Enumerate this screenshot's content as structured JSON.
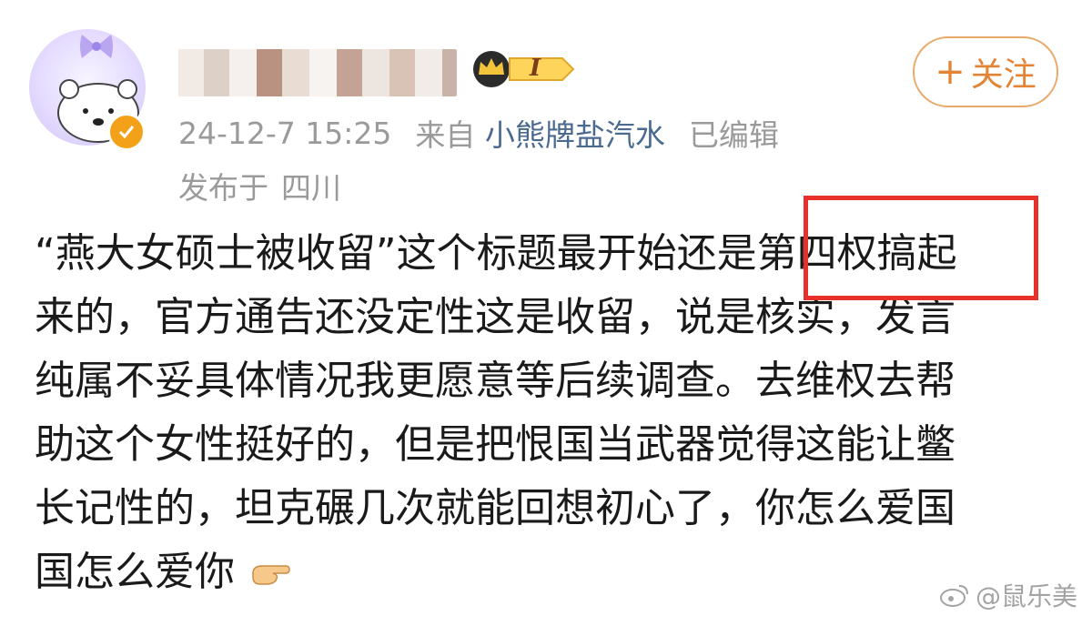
{
  "post": {
    "timestamp": "24-12-7 15:25",
    "source_prefix": "来自",
    "source_app": "小熊牌盐汽水",
    "edited_label": "已编辑",
    "location_prefix": "发布于",
    "location": "四川",
    "vip_level": "I",
    "follow_label": "关注",
    "follow_plus": "+",
    "text_lines": [
      "“燕大女硕士被收留”这个标题最开始还是第四权搞起",
      "来的，官方通告还没定性这是收留，说是核实，发言",
      "纯属不妥具体情况我更愿意等后续调查。去维权去帮",
      "助这个女性挺好的，但是把恨国当武器觉得这能让鳖",
      "长记性的，坦克碾几次就能回想初心了，你怎么爱国",
      "国怎么爱你"
    ]
  },
  "watermark": {
    "text": "@鼠乐美",
    "icon": "weibo-icon"
  },
  "colors": {
    "accent": "#e38434",
    "highlight_box": "#e8302a",
    "source_link": "#4b6a8f",
    "meta": "#9a9a9a",
    "verified": "#f4a11a"
  },
  "icons": {
    "avatar": "bear-avatar",
    "verified": "verified-icon",
    "vip": "crown-icon",
    "emoji": "pointing-hand-icon"
  }
}
